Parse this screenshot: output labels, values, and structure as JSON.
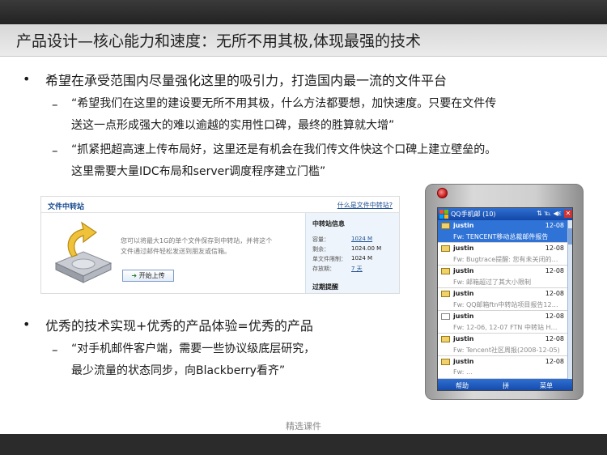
{
  "slide": {
    "title": "产品设计—核心能力和速度：无所不用其极,体现最强的技术",
    "bullet1": "希望在承受范围内尽量强化这里的吸引力，打造国内最一流的文件平台",
    "sub1_line1": "“希望我们在这里的建设要无所不用其极，什么方法都要想，加快速度。只要在文件传",
    "sub1_line2": "送这一点形成强大的难以逾越的实用性口碑，最终的胜算就大增”",
    "sub2_line1": "“抓紧把超高速上传布局好，这里还是有机会在我们传文件快这个口碑上建立壁垒的。",
    "sub2_line2": "这里需要大量IDC布局和server调度程序建立门槛”",
    "bullet2": "优秀的技术实现+优秀的产品体验=优秀的产品",
    "sub3_line1": "“对手机邮件客户端，需要一些协议级底层研究，",
    "sub3_line2": "最少流量的状态同步，向Blackberry看齐”",
    "bullet_symbol": "•",
    "dash_symbol": "–",
    "footer": "精选课件"
  },
  "file_transfer": {
    "title": "文件中转站",
    "help_link": "什么是文件中转站?",
    "desc_line1": "您可以将最大1G的单个文件保存到中转站，并将这个",
    "desc_line2": "文件通过邮件轻松发送到朋友或信箱。",
    "upload_button": "开始上传",
    "info_title": "中转站信息",
    "rows": [
      {
        "label": "容量：",
        "value": "1024 M"
      },
      {
        "label": "剩余：",
        "value": "1024.00 M"
      },
      {
        "label": "单文件限制：",
        "value": "1024 M"
      },
      {
        "label": "存放期：",
        "value": "7 天"
      }
    ],
    "expire_title": "过期提醒"
  },
  "phone": {
    "app_title": "QQ手机邮 (10)",
    "status_icons": "⇅ ℡ ◀ε",
    "close": "✕",
    "mails": [
      {
        "from": "justin",
        "date": "12-08",
        "subject": "Fw: TENCENT移动总裁邮件报告",
        "selected": true,
        "opened": false
      },
      {
        "from": "justin",
        "date": "12-08",
        "subject": "Fw: Bugtrace提醒: 您有未关闭的…",
        "selected": false,
        "opened": false
      },
      {
        "from": "justin",
        "date": "12-08",
        "subject": "Fw: 邮箱超过了其大小限制",
        "selected": false,
        "opened": false
      },
      {
        "from": "justin",
        "date": "12-08",
        "subject": "Fw: QQ邮箱ftn中转站项目报告12…",
        "selected": false,
        "opened": false
      },
      {
        "from": "justin",
        "date": "12-08",
        "subject": "Fw: 12-06, 12-07 FTN 中转站 H…",
        "selected": false,
        "opened": true
      },
      {
        "from": "justin",
        "date": "12-08",
        "subject": "Fw: Tencent社区周报(2008-12-05)",
        "selected": false,
        "opened": false
      },
      {
        "from": "justin",
        "date": "12-08",
        "subject": "Fw: …",
        "selected": false,
        "opened": false
      }
    ],
    "softkey_left": "帮助",
    "softkey_mid": "拼",
    "softkey_right": "菜单"
  }
}
